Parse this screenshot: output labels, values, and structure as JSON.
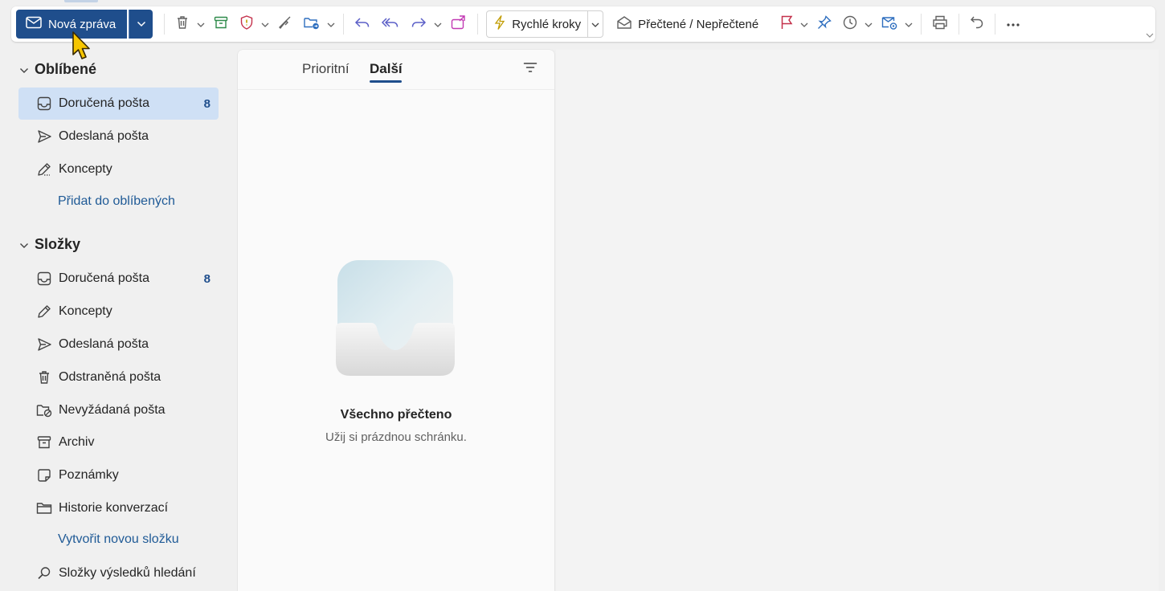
{
  "toolbar": {
    "new_message_label": "Nová zpráva",
    "quick_steps_label": "Rychlé kroky",
    "read_unread_label": "Přečtené / Nepřečtené"
  },
  "favorites": {
    "header": "Oblíbené",
    "items": [
      {
        "label": "Doručená pošta",
        "count": "8",
        "icon": "inbox-icon",
        "selected": true
      },
      {
        "label": "Odeslaná pošta",
        "icon": "send-icon"
      },
      {
        "label": "Koncepty",
        "icon": "drafts-icon"
      }
    ],
    "add_link": "Přidat do oblíbených"
  },
  "folders": {
    "header": "Složky",
    "items": [
      {
        "label": "Doručená pošta",
        "count": "8",
        "icon": "inbox-icon"
      },
      {
        "label": "Koncepty",
        "icon": "pencil-icon"
      },
      {
        "label": "Odeslaná pošta",
        "icon": "send-icon"
      },
      {
        "label": "Odstraněná pošta",
        "icon": "trash-icon"
      },
      {
        "label": "Nevyžádaná pošta",
        "icon": "junk-folder-icon"
      },
      {
        "label": "Archiv",
        "icon": "archive-icon"
      },
      {
        "label": "Poznámky",
        "icon": "note-icon"
      },
      {
        "label": "Historie konverzací",
        "icon": "folder-icon"
      }
    ],
    "create_link": "Vytvořit novou složku",
    "search_folders": {
      "label": "Složky výsledků hledání",
      "icon": "search-icon"
    }
  },
  "message_list": {
    "tabs": [
      {
        "label": "Prioritní",
        "active": false
      },
      {
        "label": "Další",
        "active": true
      }
    ],
    "empty_title": "Všechno přečteno",
    "empty_subtitle": "Užij si prázdnou schránku."
  },
  "colors": {
    "accent": "#1f4e8c",
    "selected_bg": "#cfe0f5",
    "link": "#1f5a96",
    "flag": "#c4314b",
    "categorize": "#c239b3",
    "quick_steps": "#c19c00"
  }
}
